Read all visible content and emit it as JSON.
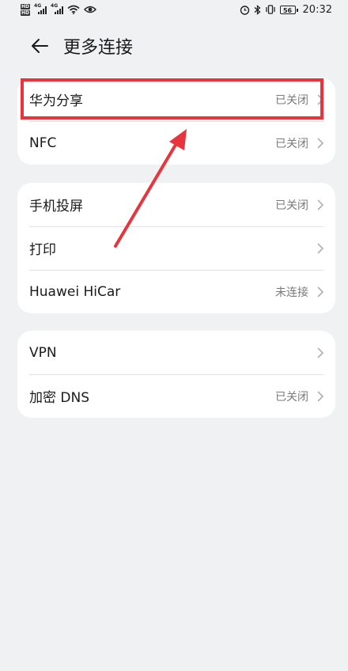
{
  "status_bar": {
    "hd_badges": [
      "HD",
      "HD"
    ],
    "signal_tags": [
      "4G",
      "4G"
    ],
    "battery": "56",
    "time": "20:32"
  },
  "header": {
    "title": "更多连接"
  },
  "groups": [
    {
      "items": [
        {
          "label": "华为分享",
          "value": "已关闭"
        },
        {
          "label": "NFC",
          "value": "已关闭"
        }
      ]
    },
    {
      "items": [
        {
          "label": "手机投屏",
          "value": "已关闭"
        },
        {
          "label": "打印",
          "value": ""
        },
        {
          "label": "Huawei HiCar",
          "value": "未连接"
        }
      ]
    },
    {
      "items": [
        {
          "label": "VPN",
          "value": ""
        },
        {
          "label": "加密 DNS",
          "value": "已关闭"
        }
      ]
    }
  ],
  "annotation": {
    "color": "#e8353d"
  },
  "colors": {
    "background": "#f0f1f3",
    "card": "#ffffff",
    "secondary_text": "#7a7a7a"
  }
}
